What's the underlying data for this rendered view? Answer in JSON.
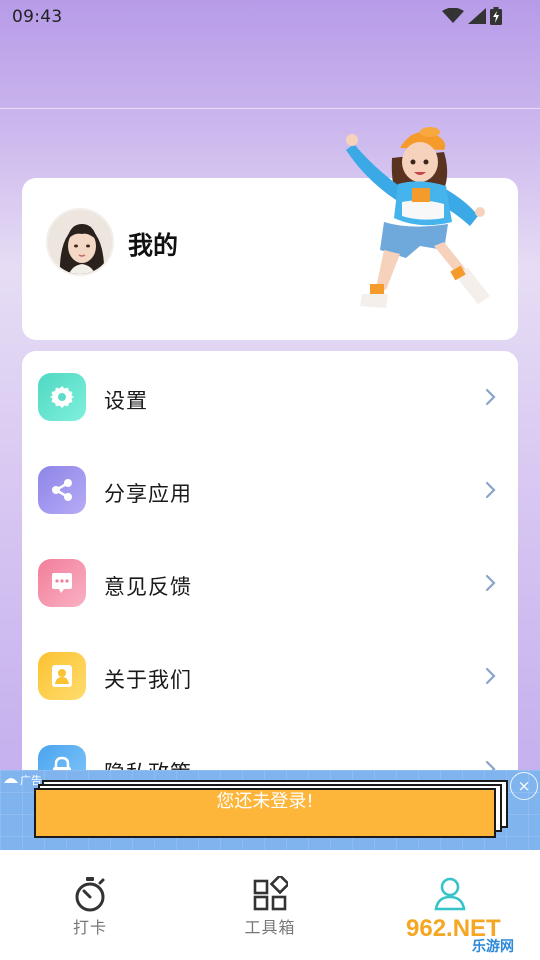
{
  "status_bar": {
    "time": "09:43"
  },
  "profile": {
    "name": "我的"
  },
  "menu": {
    "items": [
      {
        "label": "设置",
        "icon": "gear-icon",
        "color_from": "#4fd8c3",
        "color_to": "#7ff0dc"
      },
      {
        "label": "分享应用",
        "icon": "share-icon",
        "color_from": "#8e84e8",
        "color_to": "#b6acf6"
      },
      {
        "label": "意见反馈",
        "icon": "feedback-icon",
        "color_from": "#f27e9a",
        "color_to": "#f9b1c3"
      },
      {
        "label": "关于我们",
        "icon": "user-icon",
        "color_from": "#fbc231",
        "color_to": "#ffdc6e"
      },
      {
        "label": "隐私政策",
        "icon": "lock-icon",
        "color_from": "#49a4ee",
        "color_to": "#86c8fb"
      }
    ]
  },
  "ad": {
    "tag": "广告",
    "button_text": "您还未登录!",
    "accent": "#fdb53a"
  },
  "tabs": [
    {
      "label": "打卡",
      "icon": "stopwatch-icon"
    },
    {
      "label": "工具箱",
      "icon": "toolbox-icon"
    },
    {
      "label": "",
      "icon": "profile-icon"
    }
  ],
  "watermark": {
    "brand": "962.NET",
    "site": "乐游网"
  },
  "colors": {
    "active_tab": "#36c4c9",
    "inactive_tab": "#777777",
    "chevron": "#8aa4c8"
  }
}
